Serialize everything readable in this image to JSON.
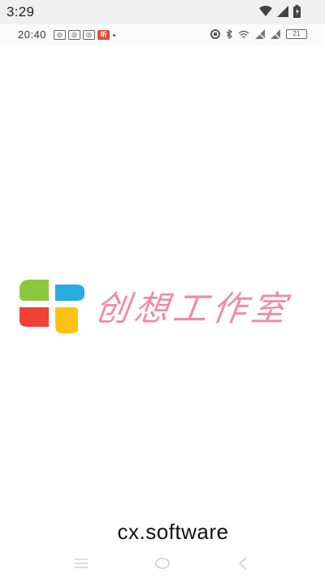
{
  "status_bar": {
    "time": "3:29",
    "icons": [
      "wifi-icon",
      "signal-icon",
      "battery-icon"
    ]
  },
  "inner_status": {
    "time": "20:40",
    "notifications": [
      "app-icon",
      "app-icon",
      "app-icon",
      "听"
    ],
    "battery_level": "21"
  },
  "splash": {
    "logo_text": "创想工作室",
    "brand_label": "cx.software",
    "colors": {
      "green": "#8cc63f",
      "blue": "#29abe2",
      "red": "#ef4136",
      "yellow": "#ffc20e",
      "text_pink": "#f08aa8"
    }
  },
  "nav_bar": {
    "buttons": [
      "menu-icon",
      "home-icon",
      "back-icon"
    ]
  }
}
